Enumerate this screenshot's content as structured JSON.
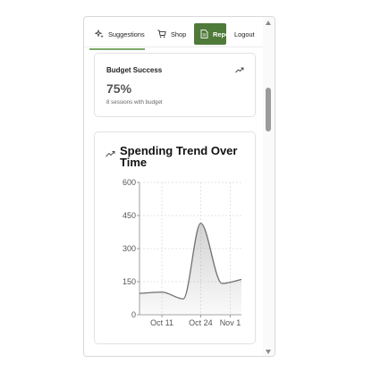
{
  "nav": {
    "items": [
      {
        "label": "Suggestions",
        "icon": "sparkle-icon"
      },
      {
        "label": "Shop",
        "icon": "cart-icon"
      },
      {
        "label": "Reports",
        "icon": "document-icon",
        "active": true
      },
      {
        "label": "Logout"
      }
    ],
    "active_color": "#4f7a3a"
  },
  "budget_card": {
    "title": "Budget Success",
    "value": "75%",
    "subtitle": "8 sessions with budget",
    "icon": "trend-up-icon"
  },
  "trend_card": {
    "title": "Spending Trend Over Time",
    "icon": "trend-up-icon"
  },
  "chart_data": {
    "type": "area",
    "title": "",
    "xlabel": "",
    "ylabel": "",
    "x_ticks": [
      "Oct 11",
      "Oct 24",
      "Nov 1"
    ],
    "y_ticks": [
      0,
      150,
      300,
      450,
      600
    ],
    "ylim": [
      0,
      600
    ],
    "grid": true,
    "series": [
      {
        "points": [
          {
            "x": 0.0,
            "y": 97
          },
          {
            "x": 0.22,
            "y": 103
          },
          {
            "x": 0.43,
            "y": 72
          },
          {
            "x": 0.6,
            "y": 415
          },
          {
            "x": 0.81,
            "y": 142
          },
          {
            "x": 1.0,
            "y": 160
          }
        ]
      }
    ],
    "x_tick_positions": [
      0.22,
      0.6,
      0.89
    ],
    "line_color": "#6f6f6f"
  }
}
